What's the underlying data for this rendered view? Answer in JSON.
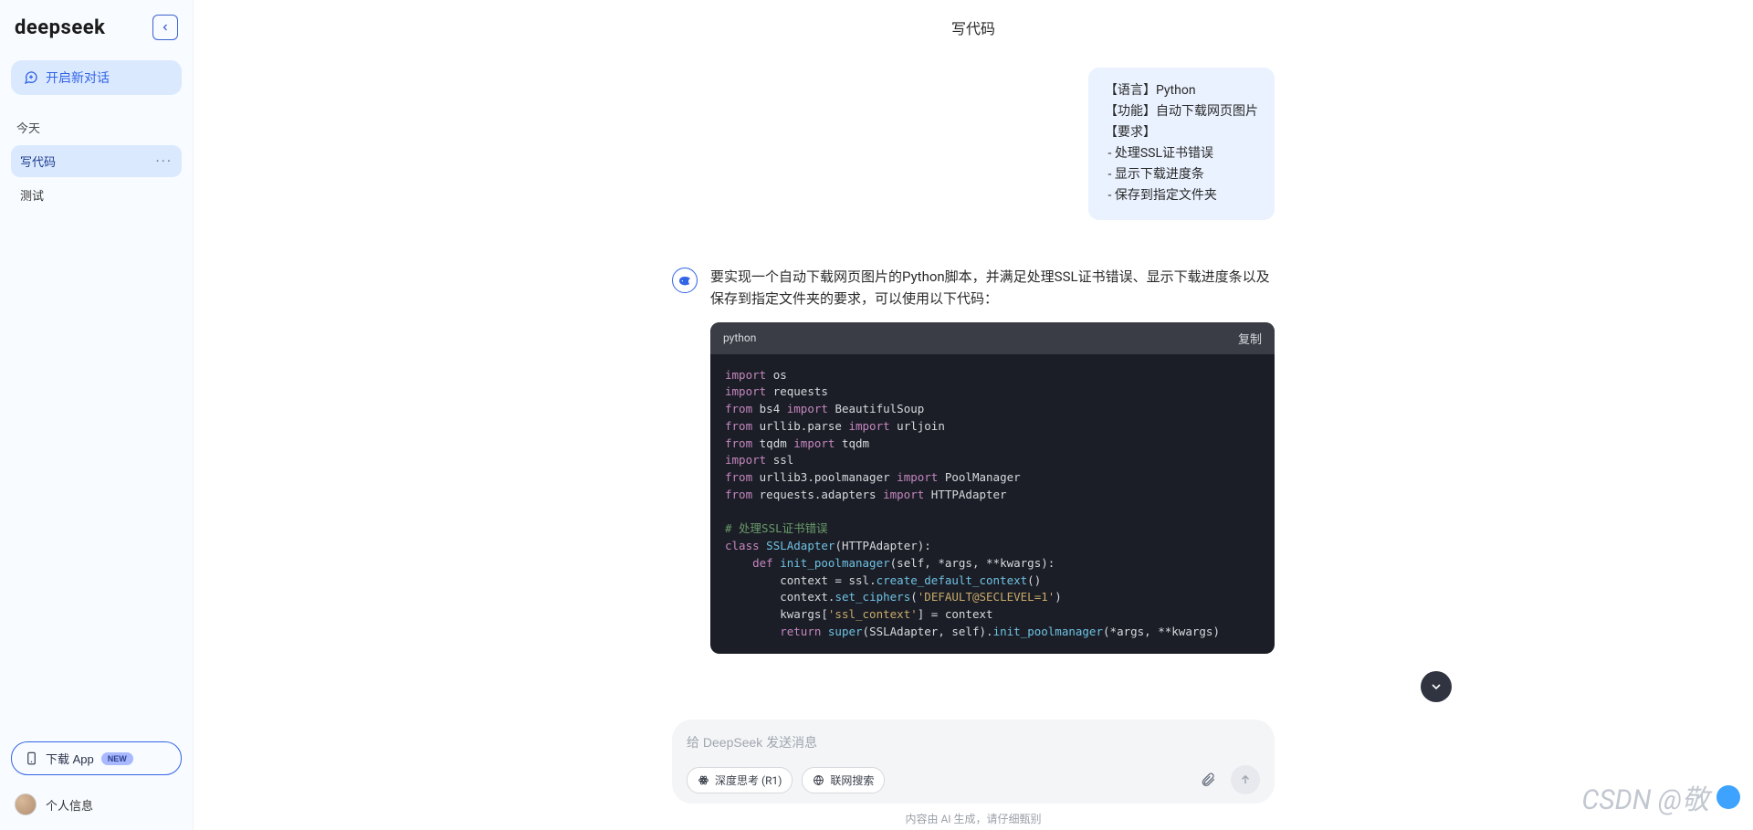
{
  "brand": "deepseek",
  "sidebar": {
    "new_chat_label": "开启新对话",
    "section_today": "今天",
    "items": [
      {
        "label": "写代码"
      },
      {
        "label": "测试"
      }
    ],
    "download_label": "下载 App",
    "download_badge": "NEW",
    "profile_label": "个人信息"
  },
  "header": {
    "title": "写代码"
  },
  "conversation": {
    "user_message": "【语言】Python\n【功能】自动下载网页图片\n【要求】\n - 处理SSL证书错误\n - 显示下载进度条\n - 保存到指定文件夹",
    "assistant_intro": "要实现一个自动下载网页图片的Python脚本，并满足处理SSL证书错误、显示下载进度条以及保存到指定文件夹的要求，可以使用以下代码：",
    "code": {
      "lang": "python",
      "copy_label": "复制",
      "tokens": [
        [
          "kw",
          "import"
        ],
        [
          "ws",
          " "
        ],
        [
          "builtin",
          "os"
        ],
        [
          "nl"
        ],
        [
          "kw",
          "import"
        ],
        [
          "ws",
          " "
        ],
        [
          "builtin",
          "requests"
        ],
        [
          "nl"
        ],
        [
          "kw",
          "from"
        ],
        [
          "ws",
          " "
        ],
        [
          "builtin",
          "bs4"
        ],
        [
          "ws",
          " "
        ],
        [
          "kw",
          "import"
        ],
        [
          "ws",
          " "
        ],
        [
          "builtin",
          "BeautifulSoup"
        ],
        [
          "nl"
        ],
        [
          "kw",
          "from"
        ],
        [
          "ws",
          " "
        ],
        [
          "builtin",
          "urllib.parse"
        ],
        [
          "ws",
          " "
        ],
        [
          "kw",
          "import"
        ],
        [
          "ws",
          " "
        ],
        [
          "builtin",
          "urljoin"
        ],
        [
          "nl"
        ],
        [
          "kw",
          "from"
        ],
        [
          "ws",
          " "
        ],
        [
          "builtin",
          "tqdm"
        ],
        [
          "ws",
          " "
        ],
        [
          "kw",
          "import"
        ],
        [
          "ws",
          " "
        ],
        [
          "builtin",
          "tqdm"
        ],
        [
          "nl"
        ],
        [
          "kw",
          "import"
        ],
        [
          "ws",
          " "
        ],
        [
          "builtin",
          "ssl"
        ],
        [
          "nl"
        ],
        [
          "kw",
          "from"
        ],
        [
          "ws",
          " "
        ],
        [
          "builtin",
          "urllib3.poolmanager"
        ],
        [
          "ws",
          " "
        ],
        [
          "kw",
          "import"
        ],
        [
          "ws",
          " "
        ],
        [
          "builtin",
          "PoolManager"
        ],
        [
          "nl"
        ],
        [
          "kw",
          "from"
        ],
        [
          "ws",
          " "
        ],
        [
          "builtin",
          "requests.adapters"
        ],
        [
          "ws",
          " "
        ],
        [
          "kw",
          "import"
        ],
        [
          "ws",
          " "
        ],
        [
          "builtin",
          "HTTPAdapter"
        ],
        [
          "nl"
        ],
        [
          "nl"
        ],
        [
          "comment",
          "# 处理SSL证书错误"
        ],
        [
          "nl"
        ],
        [
          "kw",
          "class"
        ],
        [
          "ws",
          " "
        ],
        [
          "fn",
          "SSLAdapter"
        ],
        [
          "white",
          "("
        ],
        [
          "builtin",
          "HTTPAdapter"
        ],
        [
          "white",
          "):"
        ],
        [
          "nl"
        ],
        [
          "ws",
          "    "
        ],
        [
          "kw",
          "def"
        ],
        [
          "ws",
          " "
        ],
        [
          "fn",
          "init_poolmanager"
        ],
        [
          "white",
          "("
        ],
        [
          "builtin",
          "self"
        ],
        [
          "white",
          ", *"
        ],
        [
          "builtin",
          "args"
        ],
        [
          "white",
          ", **"
        ],
        [
          "builtin",
          "kwargs"
        ],
        [
          "white",
          "):"
        ],
        [
          "nl"
        ],
        [
          "ws",
          "        "
        ],
        [
          "builtin",
          "context"
        ],
        [
          "white",
          " = "
        ],
        [
          "builtin",
          "ssl"
        ],
        [
          "white",
          "."
        ],
        [
          "fn",
          "create_default_context"
        ],
        [
          "white",
          "()"
        ],
        [
          "nl"
        ],
        [
          "ws",
          "        "
        ],
        [
          "builtin",
          "context"
        ],
        [
          "white",
          "."
        ],
        [
          "fn",
          "set_ciphers"
        ],
        [
          "white",
          "("
        ],
        [
          "str",
          "'DEFAULT@SECLEVEL=1'"
        ],
        [
          "white",
          ")"
        ],
        [
          "nl"
        ],
        [
          "ws",
          "        "
        ],
        [
          "builtin",
          "kwargs"
        ],
        [
          "white",
          "["
        ],
        [
          "str",
          "'ssl_context'"
        ],
        [
          "white",
          "] = "
        ],
        [
          "builtin",
          "context"
        ],
        [
          "nl"
        ],
        [
          "ws",
          "        "
        ],
        [
          "kw",
          "return"
        ],
        [
          "ws",
          " "
        ],
        [
          "fn",
          "super"
        ],
        [
          "white",
          "("
        ],
        [
          "builtin",
          "SSLAdapter"
        ],
        [
          "white",
          ", "
        ],
        [
          "builtin",
          "self"
        ],
        [
          "white",
          ")."
        ],
        [
          "fn",
          "init_poolmanager"
        ],
        [
          "white",
          "(*"
        ],
        [
          "builtin",
          "args"
        ],
        [
          "white",
          ", **"
        ],
        [
          "builtin",
          "kwargs"
        ],
        [
          "white",
          ")"
        ]
      ]
    }
  },
  "composer": {
    "placeholder": "给 DeepSeek 发送消息",
    "deep_think_label": "深度思考 (R1)",
    "web_search_label": "联网搜索"
  },
  "disclaimer": "内容由 AI 生成，请仔细甄别",
  "watermark": "CSDN @敬"
}
